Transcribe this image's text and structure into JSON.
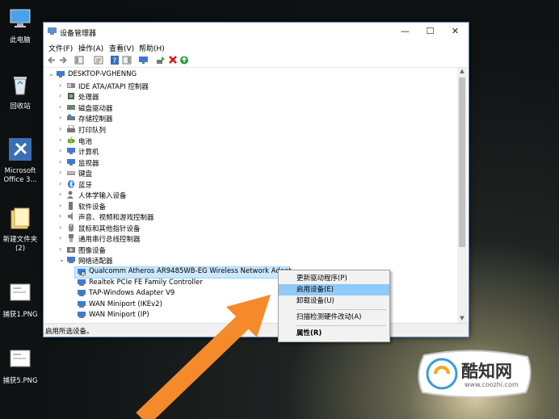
{
  "desktop": {
    "icons": [
      {
        "label": "此电脑",
        "icon": "computer-icon"
      },
      {
        "label": "回收站",
        "icon": "recycle-bin-icon"
      },
      {
        "label_line1": "Microsoft",
        "label_line2": "Office 3...",
        "icon": "office-tools-icon"
      },
      {
        "label_line1": "新建文件夹",
        "label_line2": "(2)",
        "icon": "folder-icon"
      },
      {
        "label": "捕获1.PNG",
        "icon": "image-file-icon"
      },
      {
        "label": "捕获5.PNG",
        "icon": "image-file-icon"
      }
    ]
  },
  "window": {
    "title": "设备管理器",
    "controls": {
      "minimize": "—",
      "maximize": "☐",
      "close": "✕"
    },
    "menu": [
      "文件(F)",
      "操作(A)",
      "查看(V)",
      "帮助(H)"
    ],
    "status": "启用所选设备。"
  },
  "tree": {
    "root": "DESKTOP-VGHENNG",
    "categories": [
      "IDE ATA/ATAPI 控制器",
      "处理器",
      "磁盘驱动器",
      "存储控制器",
      "打印队列",
      "电池",
      "计算机",
      "监视器",
      "键盘",
      "蓝牙",
      "人体学输入设备",
      "软件设备",
      "声音、视频和游戏控制器",
      "鼠标和其他指针设备",
      "通用串行总线控制器",
      "图像设备",
      "网络适配器"
    ],
    "network_adapters": [
      "Qualcomm Atheros AR9485WB-EG Wireless Network Adapt",
      "Realtek PCIe FE Family Controller",
      "TAP-Windows Adapter V9",
      "WAN Miniport (IKEv2)",
      "WAN Miniport (IP)"
    ]
  },
  "context_menu": {
    "items": [
      "更新驱动程序(P)",
      "启用设备(E)",
      "卸载设备(U)",
      "扫描检测硬件改动(A)",
      "属性(R)"
    ],
    "highlighted_index": 1
  },
  "watermark": {
    "brand": "酷知网",
    "url": "www.coozhi.com"
  },
  "colors": {
    "highlight": "#cce8ff",
    "menu_hover": "#91c9f7",
    "arrow": "#f58a2b",
    "window_border": "#5a83b8"
  }
}
